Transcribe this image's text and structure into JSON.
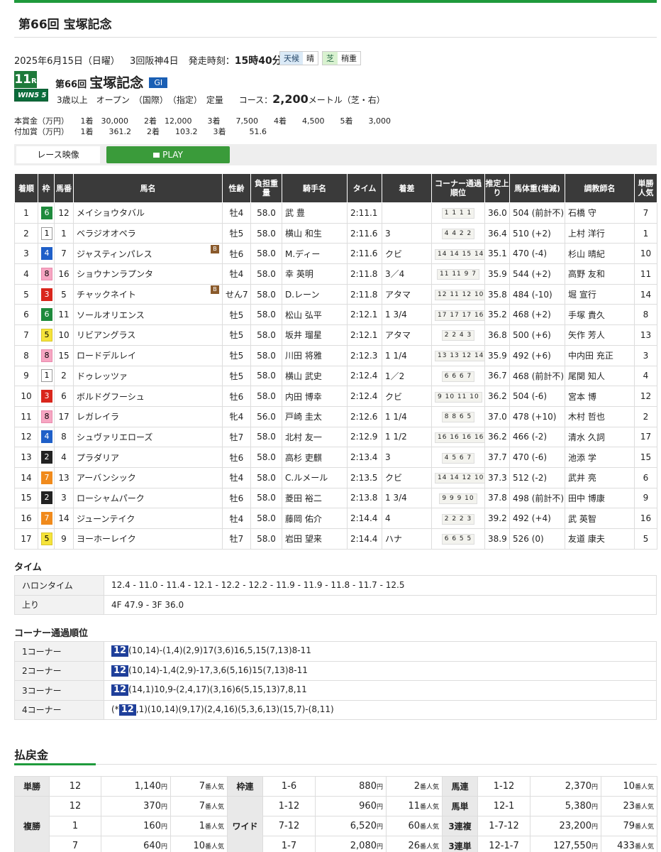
{
  "page_title": "第66回 宝塚記念",
  "meta": {
    "date": "2025年6月15日（日曜）",
    "meeting": "3回阪神4日",
    "post_label": "発走時刻：",
    "post_time": "15時40分"
  },
  "weather": {
    "label": "天候",
    "value": "晴"
  },
  "track": {
    "label": "芝",
    "value": "稍重"
  },
  "race": {
    "num": "11",
    "r": "R",
    "win5": "WIN5 5",
    "number_label": "第66回",
    "name": "宝塚記念",
    "grade": "GI",
    "conditions": "3歳以上　オープン　（国際）　（指定）　定量",
    "course_label": "コース：",
    "distance": "2,200",
    "distance_unit": "メートル（芝・右）"
  },
  "prize": {
    "line1": "本賞金（万円）　　1着　30,000　　2着　12,000　　3着　　7,500　　4着　　4,500　　5着　　3,000",
    "line2": "付加賞（万円）　　1着　　361.2　　2着　　103.2　　3着　　　51.6"
  },
  "video": {
    "label": "レース映像",
    "play": "PLAY"
  },
  "results_headers": [
    "着順",
    "枠",
    "馬番",
    "馬名",
    "性齢",
    "負担重量",
    "騎手名",
    "タイム",
    "着差",
    "コーナー通過順位",
    "推定上り",
    "馬体重(増減)",
    "調教師名",
    "単勝人気"
  ],
  "results": [
    {
      "pos": "1",
      "waku": "6",
      "num": "12",
      "name": "メイショウタバル",
      "blinker": "",
      "sexage": "牡4",
      "weight": "58.0",
      "jockey": "武 豊",
      "time": "2:11.1",
      "margin": "",
      "corner": "1 1 1 1",
      "last3f": "36.0",
      "bw": "504 (前計不)",
      "trainer": "石橋 守",
      "pop": "7"
    },
    {
      "pos": "2",
      "waku": "1",
      "num": "1",
      "name": "ベラジオオペラ",
      "blinker": "",
      "sexage": "牡5",
      "weight": "58.0",
      "jockey": "横山 和生",
      "time": "2:11.6",
      "margin": "3",
      "corner": "4 4 2 2",
      "last3f": "36.4",
      "bw": "510 (+2)",
      "trainer": "上村 洋行",
      "pop": "1"
    },
    {
      "pos": "3",
      "waku": "4",
      "num": "7",
      "name": "ジャスティンパレス",
      "blinker": "B",
      "sexage": "牡6",
      "weight": "58.0",
      "jockey": "M.ディー",
      "time": "2:11.6",
      "margin": "クビ",
      "corner": "14 14 15 14",
      "last3f": "35.1",
      "bw": "470 (-4)",
      "trainer": "杉山 晴紀",
      "pop": "10"
    },
    {
      "pos": "4",
      "waku": "8",
      "num": "16",
      "name": "ショウナンラプンタ",
      "blinker": "",
      "sexage": "牡4",
      "weight": "58.0",
      "jockey": "幸 英明",
      "time": "2:11.8",
      "margin": "3／4",
      "corner": "11 11 9 7",
      "last3f": "35.9",
      "bw": "544 (+2)",
      "trainer": "高野 友和",
      "pop": "11"
    },
    {
      "pos": "5",
      "waku": "3",
      "num": "5",
      "name": "チャックネイト",
      "blinker": "B",
      "sexage": "せん7",
      "weight": "58.0",
      "jockey": "D.レーン",
      "time": "2:11.8",
      "margin": "アタマ",
      "corner": "12 11 12 10",
      "last3f": "35.8",
      "bw": "484 (-10)",
      "trainer": "堀 宣行",
      "pop": "14"
    },
    {
      "pos": "6",
      "waku": "6",
      "num": "11",
      "name": "ソールオリエンス",
      "blinker": "",
      "sexage": "牡5",
      "weight": "58.0",
      "jockey": "松山 弘平",
      "time": "2:12.1",
      "margin": "1 3/4",
      "corner": "17 17 17 16",
      "last3f": "35.2",
      "bw": "468 (+2)",
      "trainer": "手塚 貴久",
      "pop": "8"
    },
    {
      "pos": "7",
      "waku": "5",
      "num": "10",
      "name": "リビアングラス",
      "blinker": "",
      "sexage": "牡5",
      "weight": "58.0",
      "jockey": "坂井 瑠星",
      "time": "2:12.1",
      "margin": "アタマ",
      "corner": "2 2 4 3",
      "last3f": "36.8",
      "bw": "500 (+6)",
      "trainer": "矢作 芳人",
      "pop": "13"
    },
    {
      "pos": "8",
      "waku": "8",
      "num": "15",
      "name": "ロードデルレイ",
      "blinker": "",
      "sexage": "牡5",
      "weight": "58.0",
      "jockey": "川田 将雅",
      "time": "2:12.3",
      "margin": "1 1/4",
      "corner": "13 13 12 14",
      "last3f": "35.9",
      "bw": "492 (+6)",
      "trainer": "中内田 充正",
      "pop": "3"
    },
    {
      "pos": "9",
      "waku": "1",
      "num": "2",
      "name": "ドゥレッツァ",
      "blinker": "",
      "sexage": "牡5",
      "weight": "58.0",
      "jockey": "横山 武史",
      "time": "2:12.4",
      "margin": "1／2",
      "corner": "6 6 6 7",
      "last3f": "36.7",
      "bw": "468 (前計不)",
      "trainer": "尾関 知人",
      "pop": "4"
    },
    {
      "pos": "10",
      "waku": "3",
      "num": "6",
      "name": "ボルドグフーシュ",
      "blinker": "",
      "sexage": "牡6",
      "weight": "58.0",
      "jockey": "内田 博幸",
      "time": "2:12.4",
      "margin": "クビ",
      "corner": "9 10 11 10",
      "last3f": "36.2",
      "bw": "504 (-6)",
      "trainer": "宮本 博",
      "pop": "12"
    },
    {
      "pos": "11",
      "waku": "8",
      "num": "17",
      "name": "レガレイラ",
      "blinker": "",
      "sexage": "牝4",
      "weight": "56.0",
      "jockey": "戸崎 圭太",
      "time": "2:12.6",
      "margin": "1 1/4",
      "corner": "8 8 6 5",
      "last3f": "37.0",
      "bw": "478 (+10)",
      "trainer": "木村 哲也",
      "pop": "2"
    },
    {
      "pos": "12",
      "waku": "4",
      "num": "8",
      "name": "シュヴァリエローズ",
      "blinker": "",
      "sexage": "牡7",
      "weight": "58.0",
      "jockey": "北村 友一",
      "time": "2:12.9",
      "margin": "1 1/2",
      "corner": "16 16 16 16",
      "last3f": "36.2",
      "bw": "466 (-2)",
      "trainer": "清水 久詞",
      "pop": "17"
    },
    {
      "pos": "13",
      "waku": "2",
      "num": "4",
      "name": "プラダリア",
      "blinker": "",
      "sexage": "牡6",
      "weight": "58.0",
      "jockey": "高杉 吏麒",
      "time": "2:13.4",
      "margin": "3",
      "corner": "4 5 6 7",
      "last3f": "37.7",
      "bw": "470 (-6)",
      "trainer": "池添 学",
      "pop": "15"
    },
    {
      "pos": "14",
      "waku": "7",
      "num": "13",
      "name": "アーバンシック",
      "blinker": "",
      "sexage": "牡4",
      "weight": "58.0",
      "jockey": "C.ルメール",
      "time": "2:13.5",
      "margin": "クビ",
      "corner": "14 14 12 10",
      "last3f": "37.3",
      "bw": "512 (-2)",
      "trainer": "武井 亮",
      "pop": "6"
    },
    {
      "pos": "15",
      "waku": "2",
      "num": "3",
      "name": "ローシャムパーク",
      "blinker": "",
      "sexage": "牡6",
      "weight": "58.0",
      "jockey": "菱田 裕二",
      "time": "2:13.8",
      "margin": "1 3/4",
      "corner": "9 9 9 10",
      "last3f": "37.8",
      "bw": "498 (前計不)",
      "trainer": "田中 博康",
      "pop": "9"
    },
    {
      "pos": "16",
      "waku": "7",
      "num": "14",
      "name": "ジューンテイク",
      "blinker": "",
      "sexage": "牡4",
      "weight": "58.0",
      "jockey": "藤岡 佑介",
      "time": "2:14.4",
      "margin": "4",
      "corner": "2 2 2 3",
      "last3f": "39.2",
      "bw": "492 (+4)",
      "trainer": "武 英智",
      "pop": "16"
    },
    {
      "pos": "17",
      "waku": "5",
      "num": "9",
      "name": "ヨーホーレイク",
      "blinker": "",
      "sexage": "牡7",
      "weight": "58.0",
      "jockey": "岩田 望来",
      "time": "2:14.4",
      "margin": "ハナ",
      "corner": "6 6 5 5",
      "last3f": "38.9",
      "bw": "526 (0)",
      "trainer": "友道 康夫",
      "pop": "5"
    }
  ],
  "time_section": {
    "title": "タイム",
    "halon_label": "ハロンタイム",
    "halon": "12.4 - 11.0 - 11.4 - 12.1 - 12.2 - 12.2 - 11.9 - 11.9 - 11.8 - 11.7 - 12.5",
    "agari_label": "上り",
    "agari": "4F 47.9 - 3F 36.0"
  },
  "corners_section": {
    "title": "コーナー通過順位",
    "rows": [
      {
        "label": "1コーナー",
        "pre": "",
        "lead": "12",
        "rest": "(10,14)-(1,4)(2,9)17(3,6)16,5,15(7,13)8-11"
      },
      {
        "label": "2コーナー",
        "pre": "",
        "lead": "12",
        "rest": "(10,14)-1,4(2,9)-17,3,6(5,16)15(7,13)8-11"
      },
      {
        "label": "3コーナー",
        "pre": "",
        "lead": "12",
        "rest": "(14,1)10,9-(2,4,17)(3,16)6(5,15,13)7,8,11"
      },
      {
        "label": "4コーナー",
        "pre": "(*",
        "lead": "12",
        "rest": ",1)(10,14)(9,17)(2,4,16)(5,3,6,13)(15,7)-(8,11)"
      }
    ]
  },
  "payout": {
    "title": "払戻金",
    "yen_unit": "円",
    "pop_unit": "番人気",
    "tansho": {
      "label": "単勝",
      "num": "12",
      "amount": "1,140",
      "pop": "7"
    },
    "fukusho": {
      "label": "複勝",
      "rows": [
        {
          "num": "12",
          "amount": "370",
          "pop": "7"
        },
        {
          "num": "1",
          "amount": "160",
          "pop": "1"
        },
        {
          "num": "7",
          "amount": "640",
          "pop": "10"
        }
      ]
    },
    "wakuren": {
      "label": "枠連",
      "num": "1-6",
      "amount": "880",
      "pop": "2"
    },
    "wide": {
      "label": "ワイド",
      "rows": [
        {
          "num": "1-12",
          "amount": "960",
          "pop": "11"
        },
        {
          "num": "7-12",
          "amount": "6,520",
          "pop": "60"
        },
        {
          "num": "1-7",
          "amount": "2,080",
          "pop": "26"
        }
      ]
    },
    "umaren": {
      "label": "馬連",
      "num": "1-12",
      "amount": "2,370",
      "pop": "10"
    },
    "umatan": {
      "label": "馬単",
      "num": "12-1",
      "amount": "5,380",
      "pop": "23"
    },
    "sanrenpuku": {
      "label": "3連複",
      "num": "1-7-12",
      "amount": "23,200",
      "pop": "79"
    },
    "sanrentan": {
      "label": "3連単",
      "num": "12-1-7",
      "amount": "127,550",
      "pop": "433"
    }
  }
}
